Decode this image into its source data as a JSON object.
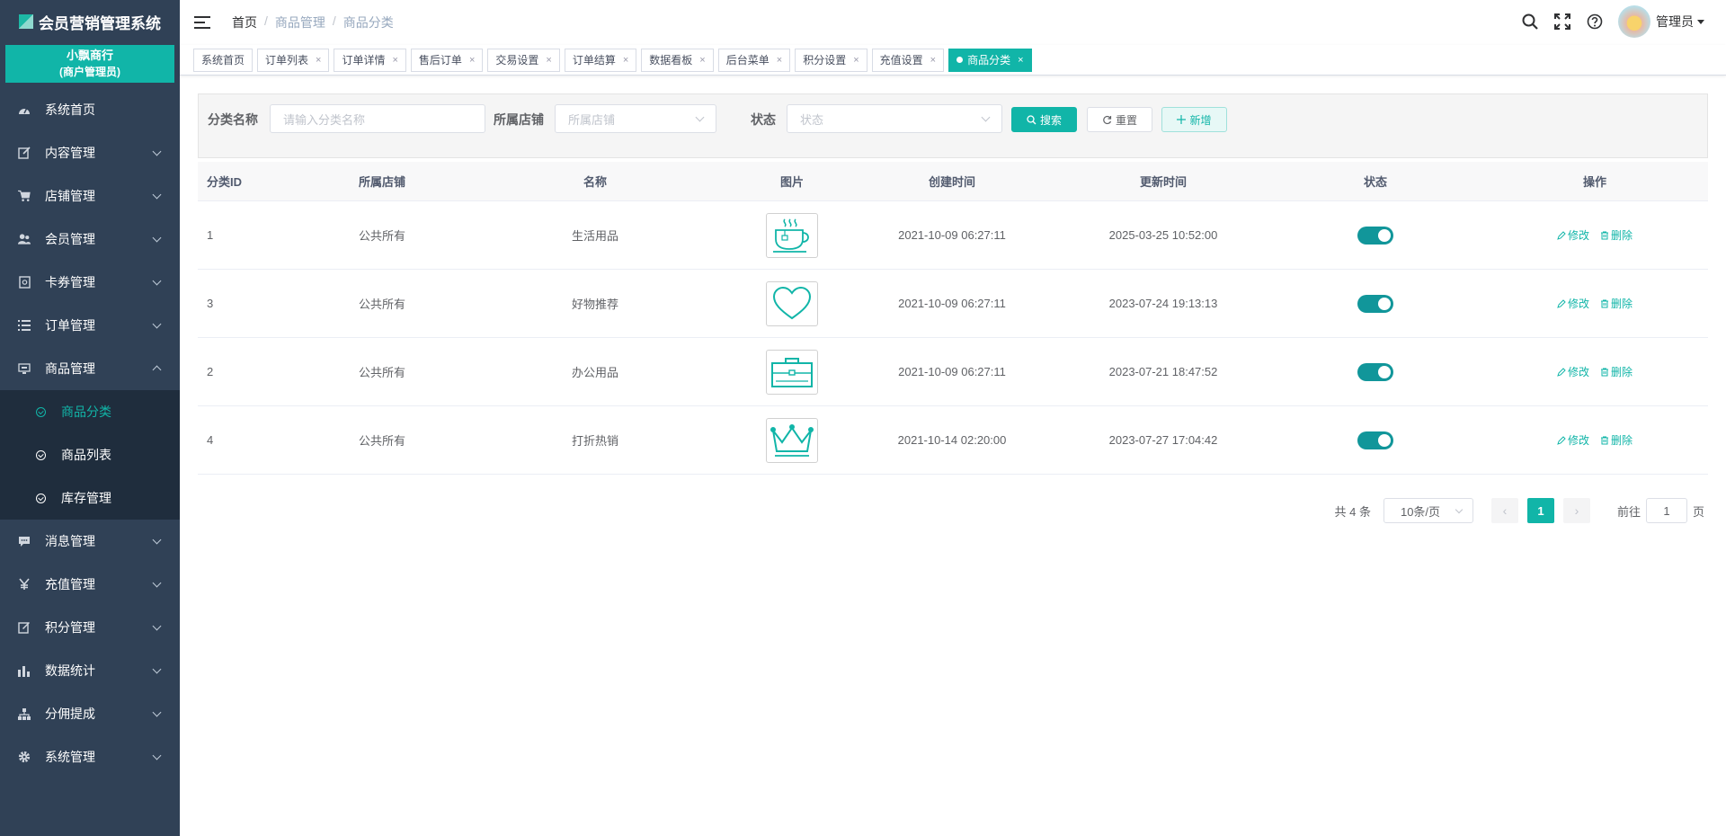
{
  "app": {
    "title": "会员营销管理系统"
  },
  "shop": {
    "name": "小飘商行",
    "role": "(商户管理员)"
  },
  "sidebar": {
    "items": [
      {
        "label": "系统首页",
        "icon": "dashboard-icon"
      },
      {
        "label": "内容管理",
        "icon": "edit-icon"
      },
      {
        "label": "店铺管理",
        "icon": "cart-icon"
      },
      {
        "label": "会员管理",
        "icon": "user-icon"
      },
      {
        "label": "卡券管理",
        "icon": "coupon-icon"
      },
      {
        "label": "订单管理",
        "icon": "list-icon"
      },
      {
        "label": "商品管理",
        "icon": "goods-icon"
      },
      {
        "label": "消息管理",
        "icon": "message-icon"
      },
      {
        "label": "充值管理",
        "icon": "yen-icon"
      },
      {
        "label": "积分管理",
        "icon": "points-icon"
      },
      {
        "label": "数据统计",
        "icon": "chart-icon"
      },
      {
        "label": "分佣提成",
        "icon": "sitemap-icon"
      },
      {
        "label": "系统管理",
        "icon": "gear-icon"
      }
    ],
    "sub_items": [
      {
        "label": "商品分类",
        "active": true
      },
      {
        "label": "商品列表",
        "active": false
      },
      {
        "label": "库存管理",
        "active": false
      }
    ]
  },
  "header": {
    "breadcrumb": [
      "首页",
      "商品管理",
      "商品分类"
    ],
    "user": "管理员"
  },
  "tags": [
    {
      "label": "系统首页",
      "closable": false
    },
    {
      "label": "订单列表",
      "closable": true
    },
    {
      "label": "订单详情",
      "closable": true
    },
    {
      "label": "售后订单",
      "closable": true
    },
    {
      "label": "交易设置",
      "closable": true
    },
    {
      "label": "订单结算",
      "closable": true
    },
    {
      "label": "数据看板",
      "closable": true
    },
    {
      "label": "后台菜单",
      "closable": true
    },
    {
      "label": "积分设置",
      "closable": true
    },
    {
      "label": "充值设置",
      "closable": true
    },
    {
      "label": "商品分类",
      "closable": true,
      "active": true
    }
  ],
  "search": {
    "name_label": "分类名称",
    "name_placeholder": "请输入分类名称",
    "shop_label": "所属店铺",
    "shop_placeholder": "所属店铺",
    "status_label": "状态",
    "status_placeholder": "状态",
    "search_btn": "搜索",
    "reset_btn": "重置",
    "add_btn": "新增"
  },
  "table": {
    "headers": [
      "分类ID",
      "所属店铺",
      "名称",
      "图片",
      "创建时间",
      "更新时间",
      "状态",
      "操作"
    ],
    "edit_label": "修改",
    "delete_label": "删除",
    "rows": [
      {
        "id": "1",
        "shop": "公共所有",
        "name": "生活用品",
        "image": "teacup-icon",
        "created": "2021-10-09 06:27:11",
        "updated": "2025-03-25 10:52:00",
        "status": true
      },
      {
        "id": "3",
        "shop": "公共所有",
        "name": "好物推荐",
        "image": "heart-icon",
        "created": "2021-10-09 06:27:11",
        "updated": "2023-07-24 19:13:13",
        "status": true
      },
      {
        "id": "2",
        "shop": "公共所有",
        "name": "办公用品",
        "image": "briefcase-icon",
        "created": "2021-10-09 06:27:11",
        "updated": "2023-07-21 18:47:52",
        "status": true
      },
      {
        "id": "4",
        "shop": "公共所有",
        "name": "打折热销",
        "image": "crown-icon",
        "created": "2021-10-14 02:20:00",
        "updated": "2023-07-27 17:04:42",
        "status": true
      }
    ]
  },
  "pagination": {
    "total": "共 4 条",
    "page_size": "10条/页",
    "current": "1",
    "goto_label": "前往",
    "goto_value": "1",
    "page_unit": "页"
  },
  "colors": {
    "accent": "#11b5a8",
    "sidebar": "#304156",
    "submenu": "#1f2d3d",
    "switch_on": "#11969a"
  }
}
